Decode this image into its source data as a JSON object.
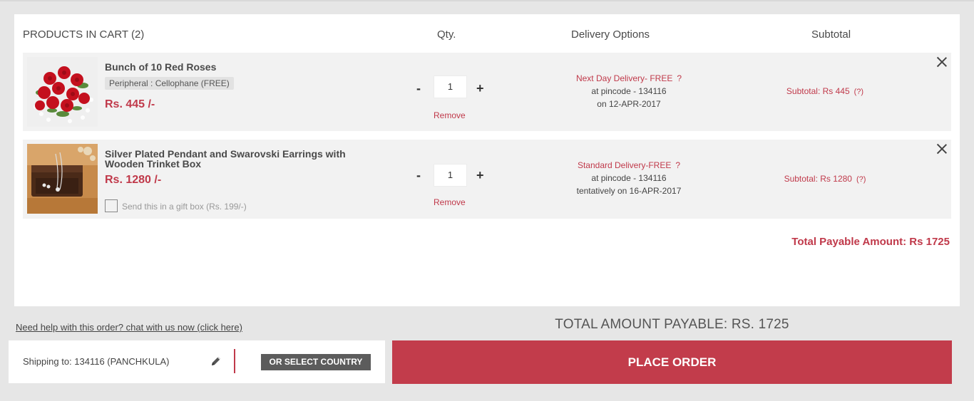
{
  "cart": {
    "header_products": "PRODUCTS IN CART (2)",
    "header_qty": "Qty.",
    "header_delivery": "Delivery Options",
    "header_subtotal": "Subtotal",
    "items": [
      {
        "name": "Bunch of 10 Red Roses",
        "tag": "Peripheral : Cellophane (FREE)",
        "price": "Rs. 445 /-",
        "qty": "1",
        "remove": "Remove",
        "delivery_title": "Next Day Delivery- FREE",
        "delivery_help": "?",
        "delivery_line2": "at pincode - 134116",
        "delivery_line3": "on 12-APR-2017",
        "subtotal": "Subtotal: Rs 445",
        "subtotal_help": "(?)"
      },
      {
        "name": "Silver Plated Pendant and Swarovski Earrings with Wooden Trinket Box",
        "price": "Rs. 1280 /-",
        "gift_box": "Send this in a gift box (Rs. 199/-)",
        "qty": "1",
        "remove": "Remove",
        "delivery_title": "Standard Delivery-FREE",
        "delivery_help": "?",
        "delivery_line2": "at pincode - 134116",
        "delivery_line3": "tentatively on 16-APR-2017",
        "subtotal": "Subtotal: Rs 1280",
        "subtotal_help": "(?)"
      }
    ],
    "qty_minus": "-",
    "qty_plus": "+",
    "total_line": "Total Payable Amount: Rs 1725"
  },
  "footer": {
    "help_link": "Need help with this order? chat with us now (click here)",
    "total_amount": "TOTAL AMOUNT PAYABLE: RS. 1725",
    "shipping_text": "Shipping to: 134116 (PANCHKULA)",
    "country_button": "OR SELECT COUNTRY",
    "place_order": "PLACE ORDER"
  },
  "colors": {
    "accent": "#c0394a",
    "place_order_bg": "#c23c4b",
    "country_button_bg": "#5c5c5c",
    "row_bg": "#f2f2f2",
    "page_bg": "#e6e6e6"
  },
  "icons": {
    "remove_item": "close-icon",
    "edit_shipping": "pencil-icon",
    "gift_checkbox": "checkbox-icon"
  }
}
